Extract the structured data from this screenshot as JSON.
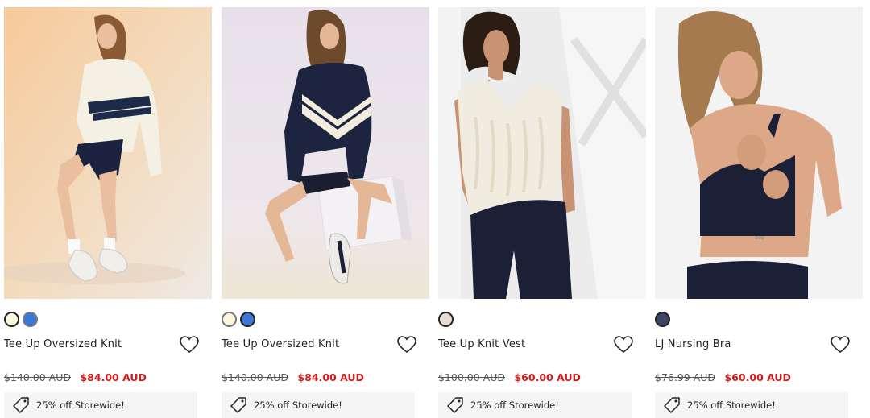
{
  "products": [
    {
      "title": "Tee Up Oversized Knit",
      "old_price": "$140.00 AUD",
      "new_price": "$84.00 AUD",
      "promo": "25% off Storewide!",
      "swatches": [
        {
          "color": "#fbf6de",
          "selected": true
        },
        {
          "color": "#3b77d8",
          "selected": false
        }
      ],
      "image": {
        "bg": "#f3dcc0",
        "top": "#f5f0e4",
        "stripe": "#1e2a4a",
        "bottom": "#1c2340",
        "skin": "#e9bfa0",
        "hair": "#8a5a34"
      }
    },
    {
      "title": "Tee Up Oversized Knit",
      "old_price": "$140.00 AUD",
      "new_price": "$84.00 AUD",
      "promo": "25% off Storewide!",
      "swatches": [
        {
          "color": "#fbf6de",
          "selected": false
        },
        {
          "color": "#3b77d8",
          "selected": true
        }
      ],
      "image": {
        "bg": "#e9e2ea",
        "top": "#1c2440",
        "stripe": "#f1ecde",
        "bottom": "#1a1e30",
        "skin": "#e4b897",
        "hair": "#6e4a2c"
      }
    },
    {
      "title": "Tee Up Knit Vest",
      "old_price": "$100.00 AUD",
      "new_price": "$60.00 AUD",
      "promo": "25% off Storewide!",
      "swatches": [
        {
          "color": "#e8ddd0",
          "selected": true
        }
      ],
      "image": {
        "bg": "#f2f2f2",
        "top": "#f1ece0",
        "stripe": "#e5dccc",
        "bottom": "#1c2036",
        "skin": "#c99272",
        "hair": "#2b1d14"
      }
    },
    {
      "title": "LJ Nursing Bra",
      "old_price": "$76.99 AUD",
      "new_price": "$60.00 AUD",
      "promo": "25% off Storewide!",
      "swatches": [
        {
          "color": "#3c4466",
          "selected": true
        }
      ],
      "image": {
        "bg": "#f4f4f4",
        "top": "#1c2036",
        "stripe": "#1c2036",
        "bottom": "#1c2036",
        "skin": "#dca888",
        "hair": "#a47a4e"
      }
    }
  ],
  "icons": {
    "wishlist": "heart-icon",
    "promo": "tag-icon"
  }
}
